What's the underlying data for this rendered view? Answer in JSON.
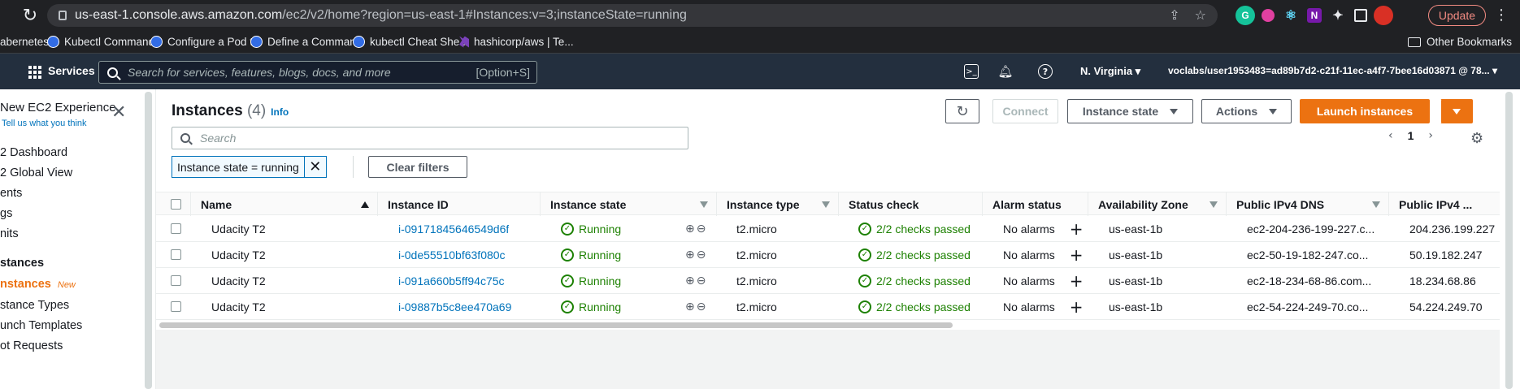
{
  "browser": {
    "url_host": "us-east-1.console.aws.amazon.com",
    "url_path": "/ec2/v2/home?region=us-east-1#Instances:v=3;instanceState=running",
    "update_label": "Update"
  },
  "bookmarks": [
    {
      "label": "abernetes",
      "icon": "none"
    },
    {
      "label": "Kubectl Commands",
      "icon": "kubernetes-icon"
    },
    {
      "label": "Configure a Pod t...",
      "icon": "kubernetes-icon"
    },
    {
      "label": "Define a Comman...",
      "icon": "kubernetes-icon"
    },
    {
      "label": "kubectl Cheat She...",
      "icon": "kubernetes-icon"
    },
    {
      "label": "hashicorp/aws | Te...",
      "icon": "hashicorp-icon"
    }
  ],
  "other_bookmarks": "Other Bookmarks",
  "aws_nav": {
    "services": "Services",
    "search_placeholder": "Search for services, features, blogs, docs, and more",
    "search_shortcut": "[Option+S]",
    "region": "N. Virginia",
    "account": "voclabs/user1953483=ad89b7d2-c21f-11ec-a4f7-7bee16d03871 @ 78..."
  },
  "leftnav": {
    "experience_title": "New EC2 Experience",
    "experience_link": "Tell us what you think",
    "items": [
      {
        "label": "2 Dashboard",
        "type": "item"
      },
      {
        "label": "2 Global View",
        "type": "item"
      },
      {
        "label": "ents",
        "type": "item"
      },
      {
        "label": "gs",
        "type": "item"
      },
      {
        "label": "nits",
        "type": "item"
      },
      {
        "label": "stances",
        "type": "section"
      },
      {
        "label": "nstances",
        "type": "active",
        "badge": "New"
      },
      {
        "label": "stance Types",
        "type": "item"
      },
      {
        "label": "unch Templates",
        "type": "item"
      },
      {
        "label": "ot Requests",
        "type": "item"
      }
    ]
  },
  "header": {
    "title": "Instances",
    "count": "(4)",
    "info": "Info",
    "connect": "Connect",
    "instance_state": "Instance state",
    "actions": "Actions",
    "launch": "Launch instances"
  },
  "search": {
    "placeholder": "Search"
  },
  "filter": {
    "token": "Instance state = running",
    "clear": "Clear filters"
  },
  "pager": {
    "page": "1"
  },
  "table": {
    "columns": [
      "Name",
      "Instance ID",
      "Instance state",
      "Instance type",
      "Status check",
      "Alarm status",
      "Availability Zone",
      "Public IPv4 DNS",
      "Public IPv4 ..."
    ],
    "rows": [
      {
        "name": "Udacity T2",
        "id": "i-09171845646549d6f",
        "state": "Running",
        "type": "t2.micro",
        "status": "2/2 checks passed",
        "alarm": "No alarms",
        "az": "us-east-1b",
        "dns": "ec2-204-236-199-227.c...",
        "ip": "204.236.199.227"
      },
      {
        "name": "Udacity T2",
        "id": "i-0de55510bf63f080c",
        "state": "Running",
        "type": "t2.micro",
        "status": "2/2 checks passed",
        "alarm": "No alarms",
        "az": "us-east-1b",
        "dns": "ec2-50-19-182-247.co...",
        "ip": "50.19.182.247"
      },
      {
        "name": "Udacity T2",
        "id": "i-091a660b5ff94c75c",
        "state": "Running",
        "type": "t2.micro",
        "status": "2/2 checks passed",
        "alarm": "No alarms",
        "az": "us-east-1b",
        "dns": "ec2-18-234-68-86.com...",
        "ip": "18.234.68.86"
      },
      {
        "name": "Udacity T2",
        "id": "i-09887b5c8ee470a69",
        "state": "Running",
        "type": "t2.micro",
        "status": "2/2 checks passed",
        "alarm": "No alarms",
        "az": "us-east-1b",
        "dns": "ec2-54-224-249-70.co...",
        "ip": "54.224.249.70"
      }
    ]
  },
  "colors": {
    "aws_orange": "#ec7211",
    "link_blue": "#0073bb",
    "success_green": "#1d8102",
    "nav_bg": "#232f3e"
  }
}
